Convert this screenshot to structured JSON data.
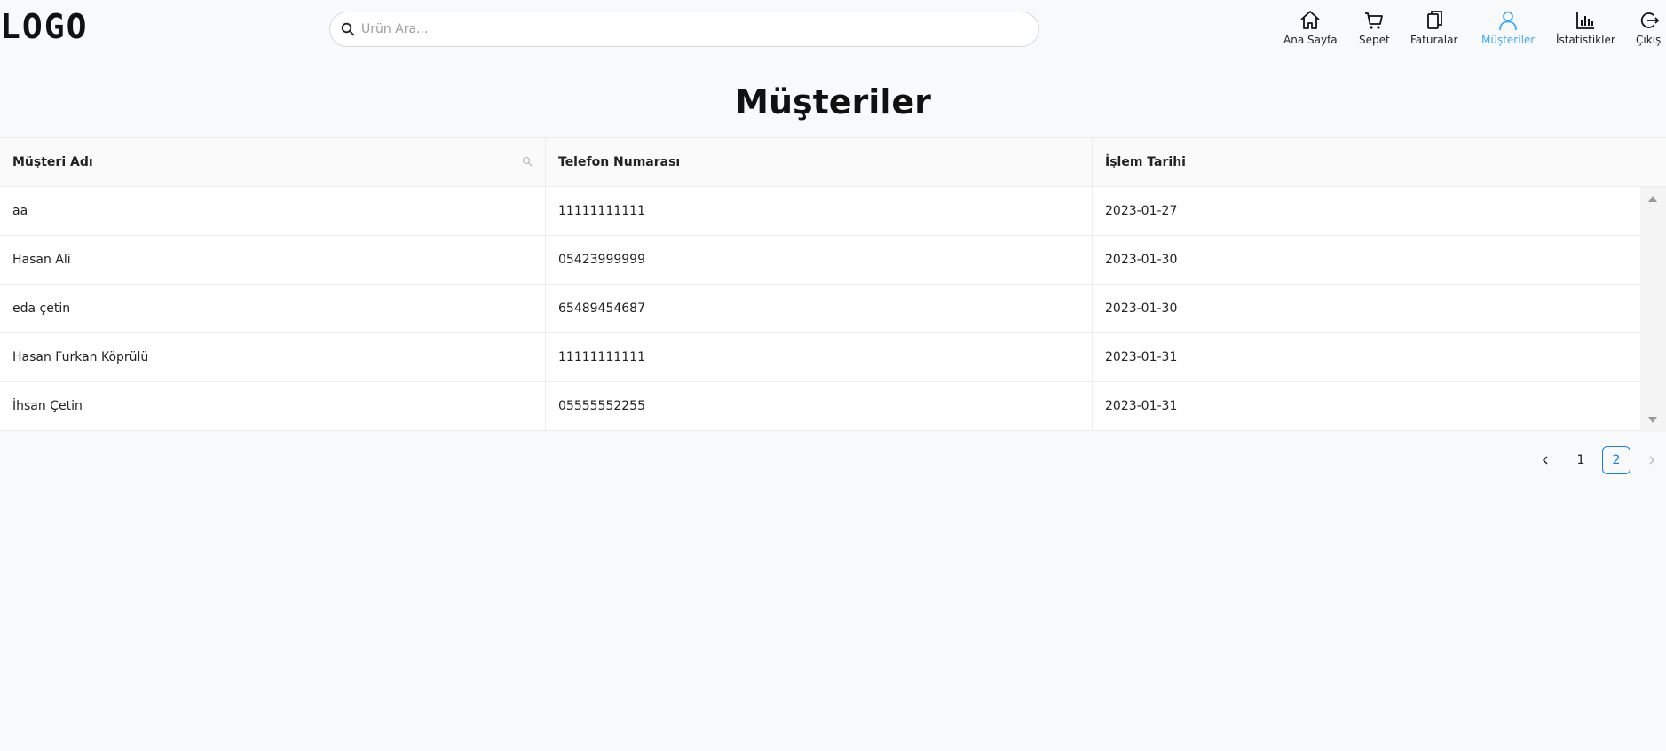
{
  "header": {
    "logo": "LOGO",
    "search": {
      "placeholder": "Ürün Ara...",
      "value": ""
    },
    "nav": [
      {
        "label": "Ana Sayfa",
        "icon": "home-icon",
        "active": false
      },
      {
        "label": "Sepet",
        "icon": "cart-icon",
        "active": false
      },
      {
        "label": "Faturalar",
        "icon": "invoices-icon",
        "active": false
      },
      {
        "label": "Müşteriler",
        "icon": "user-icon",
        "active": true
      },
      {
        "label": "İstatistikler",
        "icon": "bar-chart-icon",
        "active": false
      },
      {
        "label": "Çıkış",
        "icon": "logout-icon",
        "active": false
      }
    ],
    "active_color": "#40a9ff"
  },
  "page": {
    "title": "Müşteriler"
  },
  "table": {
    "columns": [
      "Müşteri Adı",
      "Telefon Numarası",
      "İşlem Tarihi"
    ],
    "rows": [
      [
        "aa",
        "11111111111",
        "2023-01-27"
      ],
      [
        "Hasan Ali",
        "05423999999",
        "2023-01-30"
      ],
      [
        "eda çetin",
        "65489454687",
        "2023-01-30"
      ],
      [
        "Hasan Furkan Köprülü",
        "11111111111",
        "2023-01-31"
      ],
      [
        "İhsan Çetin",
        "05555552255",
        "2023-01-31"
      ]
    ]
  },
  "pagination": {
    "pages": [
      "1",
      "2"
    ],
    "current": "2",
    "accent": "#1677ff"
  }
}
